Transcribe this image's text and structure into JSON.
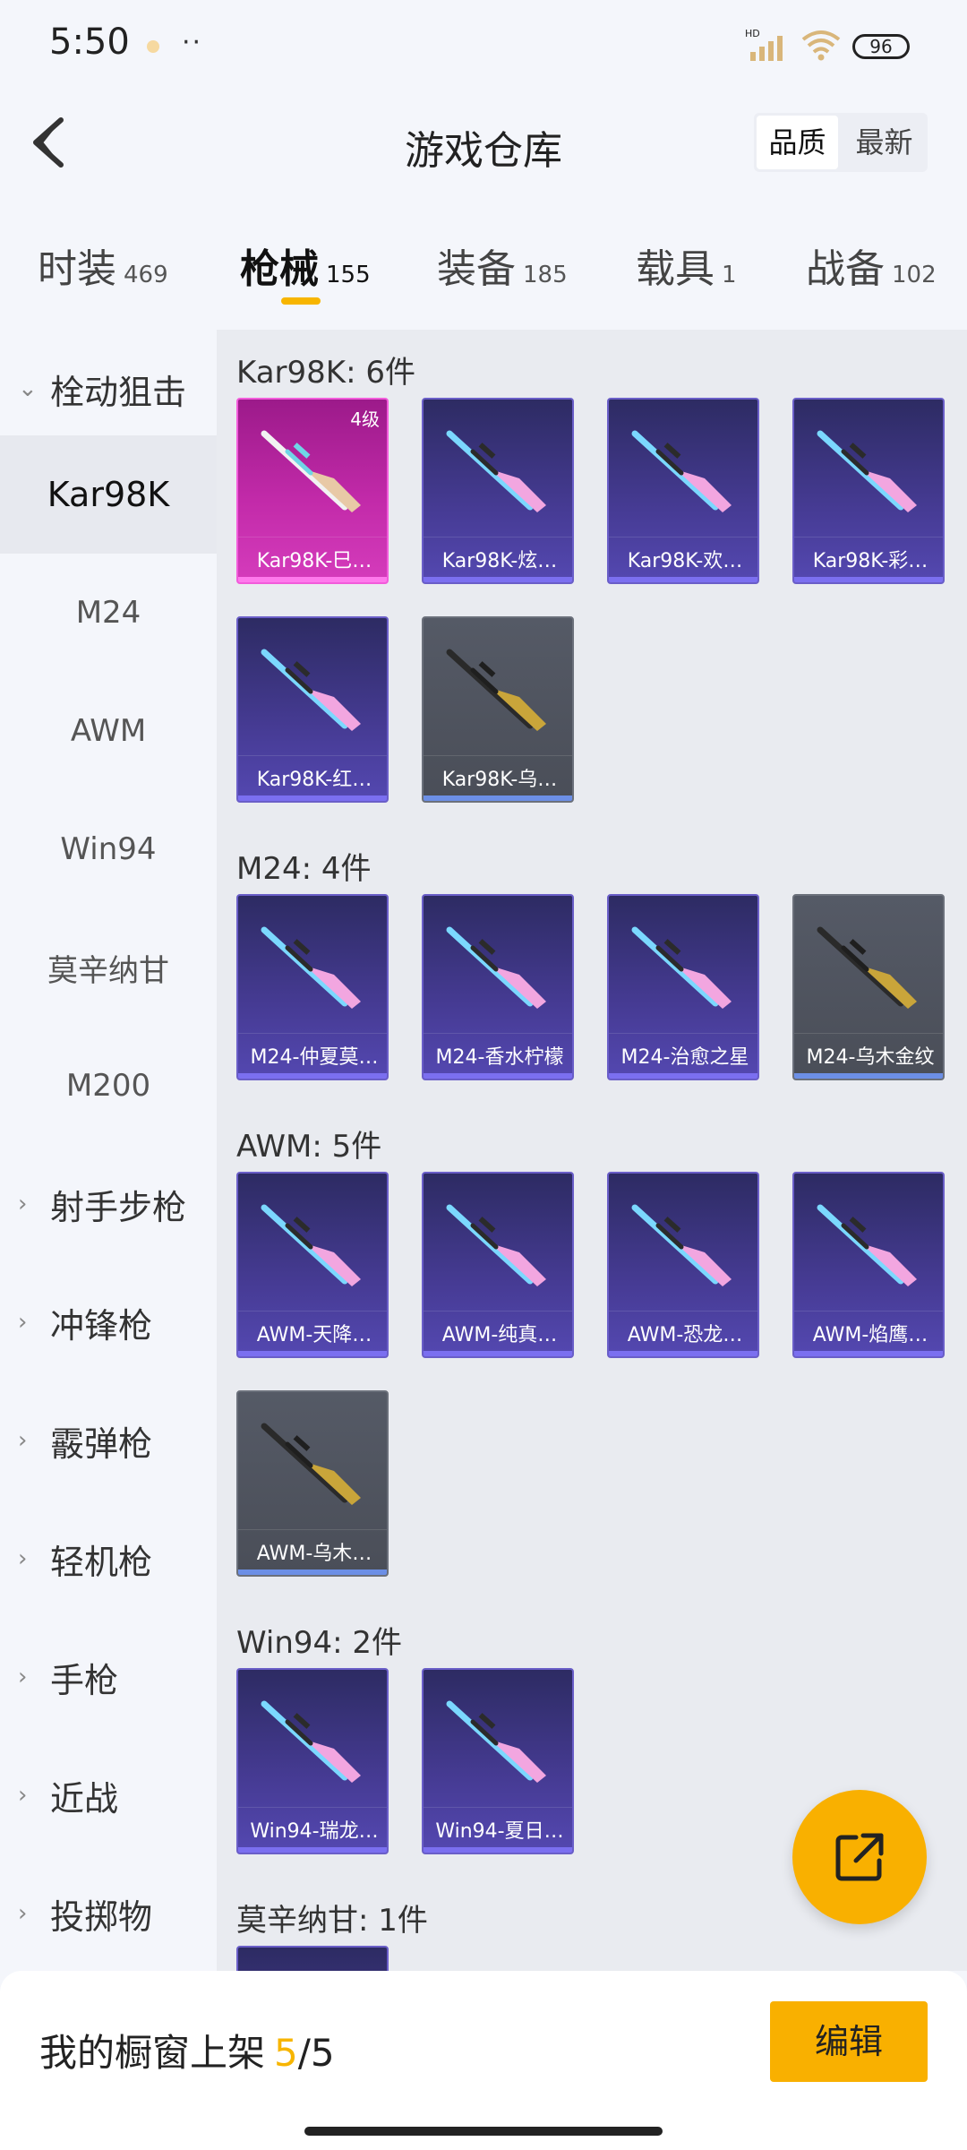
{
  "status_bar": {
    "time": "5:50",
    "network": "HD",
    "battery": "96",
    "signal_icon": "signal-bars-icon",
    "wifi_icon": "wifi-icon"
  },
  "header": {
    "title": "游戏仓库",
    "sort_options": [
      "品质",
      "最新"
    ],
    "active_sort": "品质",
    "back_icon": "back-arrow-icon"
  },
  "tabs": [
    {
      "label": "时装",
      "count": "469"
    },
    {
      "label": "枪械",
      "count": "155"
    },
    {
      "label": "装备",
      "count": "185"
    },
    {
      "label": "载具",
      "count": "1"
    },
    {
      "label": "战备",
      "count": "102"
    }
  ],
  "active_tab": "枪械",
  "sidebar": {
    "expanded_group": "栓动狙击",
    "sub_items": [
      "Kar98K",
      "M24",
      "AWM",
      "Win94",
      "莫辛纳甘",
      "M200"
    ],
    "selected_sub": "Kar98K",
    "groups": [
      "射手步枪",
      "冲锋枪",
      "霰弹枪",
      "轻机枪",
      "手枪",
      "近战",
      "投掷物"
    ]
  },
  "sections": [
    {
      "title": "Kar98K: 6件",
      "items": [
        {
          "name": "Kar98K-巳…",
          "rarity": "pink",
          "level": "4级"
        },
        {
          "name": "Kar98K-炫…",
          "rarity": "purple"
        },
        {
          "name": "Kar98K-欢…",
          "rarity": "purple"
        },
        {
          "name": "Kar98K-彩…",
          "rarity": "purple"
        },
        {
          "name": "Kar98K-红…",
          "rarity": "purple"
        },
        {
          "name": "Kar98K-乌…",
          "rarity": "gray"
        }
      ]
    },
    {
      "title": "M24: 4件",
      "items": [
        {
          "name": "M24-仲夏莫…",
          "rarity": "purple"
        },
        {
          "name": "M24-香水柠檬",
          "rarity": "purple"
        },
        {
          "name": "M24-治愈之星",
          "rarity": "purple"
        },
        {
          "name": "M24-乌木金纹",
          "rarity": "gray"
        }
      ]
    },
    {
      "title": "AWM: 5件",
      "items": [
        {
          "name": "AWM-天降…",
          "rarity": "purple"
        },
        {
          "name": "AWM-纯真…",
          "rarity": "purple"
        },
        {
          "name": "AWM-恐龙…",
          "rarity": "purple"
        },
        {
          "name": "AWM-焰鹰…",
          "rarity": "purple"
        },
        {
          "name": "AWM-乌木…",
          "rarity": "gray"
        }
      ]
    },
    {
      "title": "Win94: 2件",
      "items": [
        {
          "name": "Win94-瑞龙…",
          "rarity": "purple"
        },
        {
          "name": "Win94-夏日…",
          "rarity": "purple"
        }
      ]
    },
    {
      "title": "莫辛纳甘: 1件",
      "items": [
        {
          "name": "",
          "rarity": "purple"
        }
      ]
    }
  ],
  "fab_icon": "share-icon",
  "bottom_bar": {
    "shelf_label": "我的橱窗上架",
    "shelf_current": "5",
    "shelf_total": "/5",
    "edit_label": "编辑"
  },
  "colors": {
    "accent": "#f9b000",
    "tab_underline": "#f7b500",
    "purple_card": "#463b94",
    "pink_card": "#c22aa9",
    "gray_card": "#4a4e58"
  }
}
